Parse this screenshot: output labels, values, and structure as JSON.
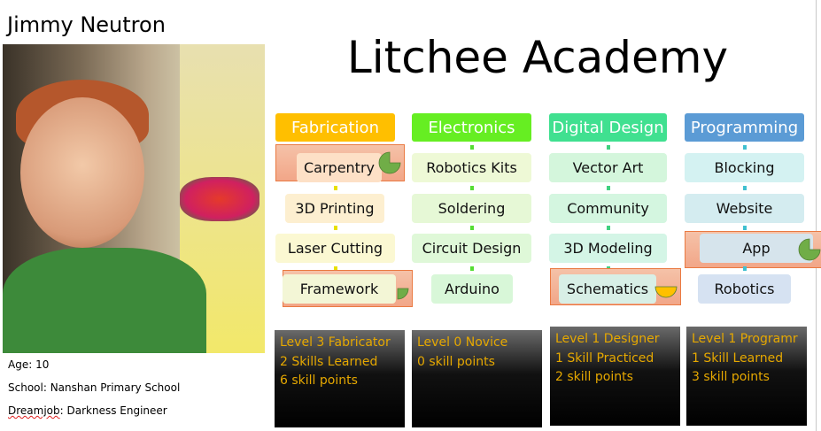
{
  "profile": {
    "name": "Jimmy Neutron",
    "age": "Age: 10",
    "school": "School: Nanshan Primary School",
    "dreamjob_label": "Dreamjob",
    "dreamjob_value": ": Darkness Engineer"
  },
  "title": "Litchee Academy",
  "columns": [
    {
      "header": "Fabrication",
      "color": "#ffbf00",
      "connector": "#e8e000",
      "skills": [
        {
          "label": "Carpentry",
          "bg": "#fde0c6",
          "highlight": true,
          "progress": 0.75,
          "pie_color": "#70ad47"
        },
        {
          "label": "3D Printing",
          "bg": "#fdefd0"
        },
        {
          "label": "Laser Cutting",
          "bg": "#fbf8d2"
        },
        {
          "label": "Framework",
          "bg": "#f3f6d6",
          "highlight": true,
          "progress": 0.25,
          "pie_color": "#70ad47"
        }
      ],
      "stats": [
        "Level 3 Fabricator",
        "2 Skills Learned",
        "6 skill points"
      ]
    },
    {
      "header": "Electronics",
      "color": "#66ee22",
      "connector": "#55dd33",
      "skills": [
        {
          "label": "Robotics Kits",
          "bg": "#eef9d6"
        },
        {
          "label": "Soldering",
          "bg": "#e6f8d6"
        },
        {
          "label": "Circuit Design",
          "bg": "#dff8d8"
        },
        {
          "label": "Arduino",
          "bg": "#d8f7d8"
        }
      ],
      "stats": [
        "Level 0 Novice",
        "0 skill points"
      ]
    },
    {
      "header": "Digital Design",
      "color": "#40e090",
      "connector": "#40d080",
      "skills": [
        {
          "label": "Vector Art",
          "bg": "#d4f6dc"
        },
        {
          "label": "Community",
          "bg": "#d4f6e0"
        },
        {
          "label": "3D Modeling",
          "bg": "#d4f5e6"
        },
        {
          "label": "Schematics",
          "bg": "#d8efe6",
          "highlight": true,
          "progress": 0.5,
          "pie_color": "#ffc000"
        }
      ],
      "stats": [
        "Level 1 Designer",
        "1 Skill Practiced",
        "2 skill points"
      ]
    },
    {
      "header": "Programming",
      "color": "#5b9bd5",
      "connector": "#40c0d0",
      "skills": [
        {
          "label": "Blocking",
          "bg": "#d4f2f2"
        },
        {
          "label": "Website",
          "bg": "#d4ecf0"
        },
        {
          "label": "App",
          "bg": "#d6e4ec",
          "highlight": true,
          "progress": 0.75,
          "pie_color": "#70ad47"
        },
        {
          "label": "Robotics",
          "bg": "#d6e2f2"
        }
      ],
      "stats": [
        "Level 1 Programr",
        "1 Skill Learned",
        "3 skill points"
      ]
    }
  ]
}
